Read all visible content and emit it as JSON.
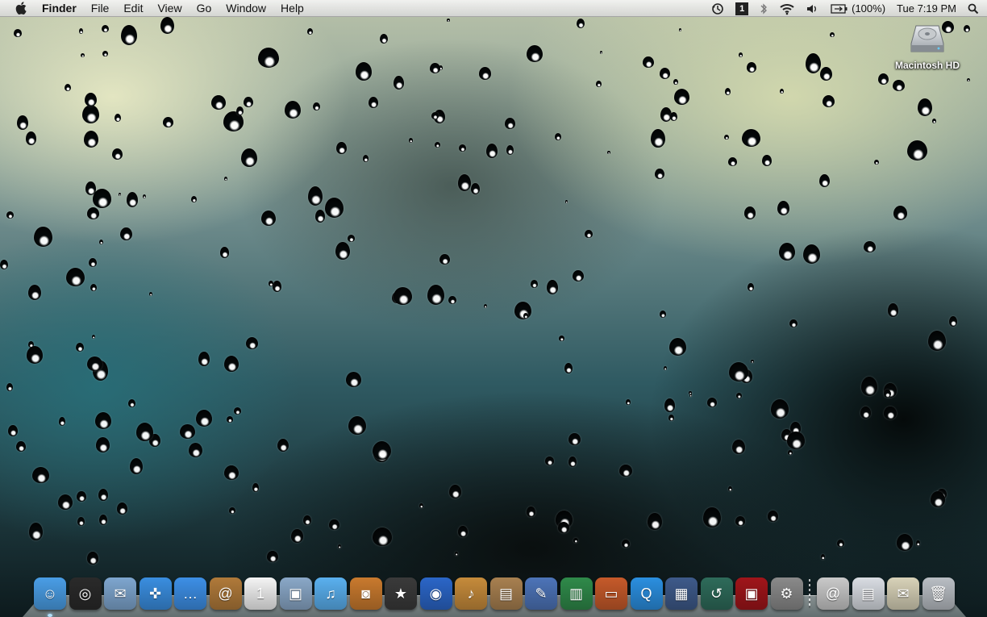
{
  "menubar": {
    "apple_icon": "apple-logo",
    "items": [
      {
        "label": "Finder",
        "bold": true
      },
      {
        "label": "File"
      },
      {
        "label": "Edit"
      },
      {
        "label": "View"
      },
      {
        "label": "Go"
      },
      {
        "label": "Window"
      },
      {
        "label": "Help"
      }
    ],
    "status": {
      "time_machine_icon": "time-machine-icon",
      "spaces_label": "1",
      "bluetooth_icon": "bluetooth-icon",
      "wifi_icon": "wifi-icon",
      "volume_icon": "volume-icon",
      "battery_percent": "(100%)",
      "clock": "Tue 7:19 PM",
      "spotlight_icon": "search-icon"
    }
  },
  "desktop": {
    "icons": [
      {
        "label": "Macintosh HD",
        "icon": "hard-drive-icon"
      }
    ]
  },
  "dock": {
    "items": [
      {
        "name": "finder",
        "icon": "finder-icon",
        "color": "#4a9ee6",
        "glyph": "☺",
        "running": true
      },
      {
        "name": "dashboard",
        "icon": "dashboard-icon",
        "color": "#2a2a2a",
        "glyph": "◎",
        "running": false
      },
      {
        "name": "mail",
        "icon": "mail-icon",
        "color": "#7ea6cf",
        "glyph": "✉",
        "running": false
      },
      {
        "name": "safari",
        "icon": "safari-icon",
        "color": "#3a8ee0",
        "glyph": "✜",
        "running": false
      },
      {
        "name": "ichat",
        "icon": "ichat-icon",
        "color": "#3d8fe6",
        "glyph": "…",
        "running": false
      },
      {
        "name": "address-book",
        "icon": "address-book-icon",
        "color": "#b07a3a",
        "glyph": "@",
        "running": false
      },
      {
        "name": "ical",
        "icon": "ical-icon",
        "color": "#f4f4f4",
        "glyph": "1",
        "running": false
      },
      {
        "name": "preview",
        "icon": "preview-icon",
        "color": "#8aa8c8",
        "glyph": "▣",
        "running": false
      },
      {
        "name": "itunes",
        "icon": "itunes-icon",
        "color": "#5ab0ef",
        "glyph": "♫",
        "running": false
      },
      {
        "name": "iphoto",
        "icon": "iphoto-icon",
        "color": "#c97a2e",
        "glyph": "◙",
        "running": false
      },
      {
        "name": "imovie",
        "icon": "imovie-icon",
        "color": "#3a3a3a",
        "glyph": "★",
        "running": false
      },
      {
        "name": "idvd",
        "icon": "idvd-icon",
        "color": "#2b66c8",
        "glyph": "◉",
        "running": false
      },
      {
        "name": "garageband",
        "icon": "garageband-icon",
        "color": "#c68b3b",
        "glyph": "♪",
        "running": false
      },
      {
        "name": "iweb",
        "icon": "iweb-icon",
        "color": "#a88050",
        "glyph": "▤",
        "running": false
      },
      {
        "name": "pages",
        "icon": "pages-icon",
        "color": "#4d74b8",
        "glyph": "✎",
        "running": false
      },
      {
        "name": "numbers",
        "icon": "numbers-icon",
        "color": "#2f8a4a",
        "glyph": "▥",
        "running": false
      },
      {
        "name": "keynote",
        "icon": "keynote-icon",
        "color": "#c65a2a",
        "glyph": "▭",
        "running": false
      },
      {
        "name": "quicktime",
        "icon": "quicktime-icon",
        "color": "#2b8fe0",
        "glyph": "Q",
        "running": false
      },
      {
        "name": "spaces",
        "icon": "spaces-icon",
        "color": "#3e5a8a",
        "glyph": "▦",
        "running": false
      },
      {
        "name": "time-machine",
        "icon": "time-machine-icon",
        "color": "#2e6b5a",
        "glyph": "↺",
        "running": false
      },
      {
        "name": "photo-booth",
        "icon": "photo-booth-icon",
        "color": "#a0151a",
        "glyph": "▣",
        "running": false
      },
      {
        "name": "system-preferences",
        "icon": "system-preferences-icon",
        "color": "#8a8a8a",
        "glyph": "⚙",
        "running": false
      }
    ],
    "stacks": [
      {
        "name": "web-sharing-stack",
        "icon": "at-sign-icon",
        "color": "#c9c9c9",
        "glyph": "@"
      },
      {
        "name": "documents-stack",
        "icon": "documents-icon",
        "color": "#d9dde3",
        "glyph": "▤"
      },
      {
        "name": "downloads-stack",
        "icon": "downloads-icon",
        "color": "#d8d2b8",
        "glyph": "✉"
      },
      {
        "name": "trash",
        "icon": "trash-icon",
        "color": "#b9bec4",
        "glyph": "🗑"
      }
    ]
  }
}
